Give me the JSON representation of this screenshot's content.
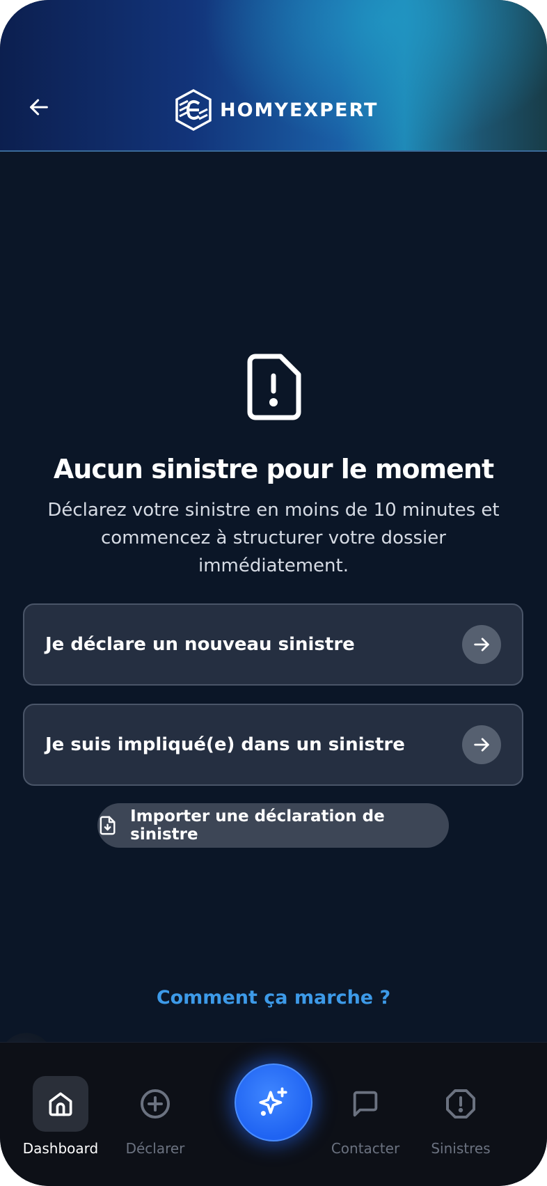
{
  "header": {
    "brand_name": "HOMYEXPERT"
  },
  "empty_state": {
    "title": "Aucun sinistre pour le moment",
    "description": "Déclarez votre sinistre en moins de 10 minutes et commencez à structurer votre dossier immédiatement."
  },
  "actions": {
    "declare_new": "Je déclare un nouveau sinistre",
    "involved": "Je suis impliqué(e) dans un sinistre",
    "import": "Importer une déclaration de sinistre"
  },
  "how_it_works": "Comment ça marche ?",
  "bottom_nav": {
    "items": [
      {
        "label": "Dashboard",
        "icon": "home-icon",
        "active": true
      },
      {
        "label": "Déclarer",
        "icon": "plus-circle-icon",
        "active": false
      },
      {
        "label": "Contacter",
        "icon": "chat-icon",
        "active": false
      },
      {
        "label": "Sinistres",
        "icon": "alert-octagon-icon",
        "active": false
      }
    ],
    "center_action_icon": "sparkles-icon"
  },
  "colors": {
    "background": "#0b1627",
    "card": "#252f41",
    "accent_link": "#3d9ae8",
    "fab": "#2563eb",
    "nav_background": "#0d1017"
  }
}
